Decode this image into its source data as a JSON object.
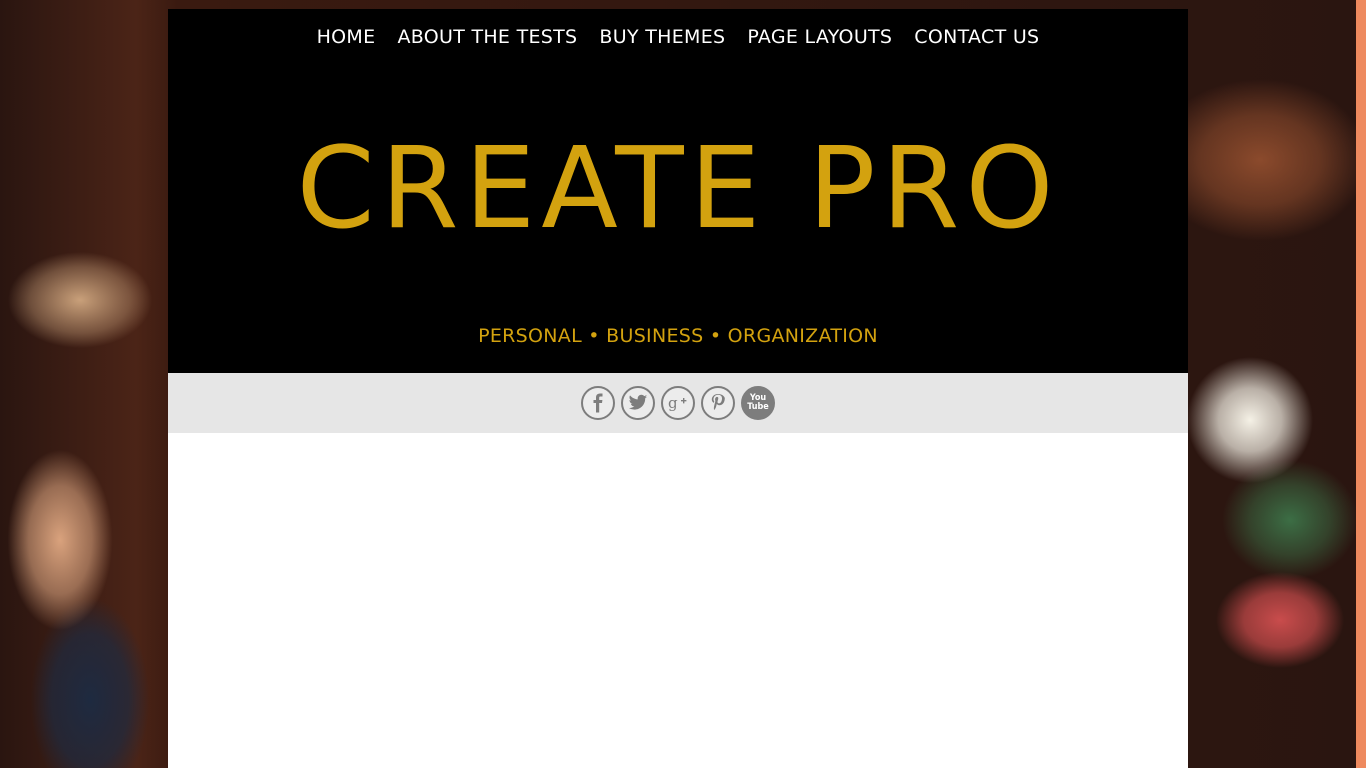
{
  "nav": {
    "items": [
      {
        "label": "HOME"
      },
      {
        "label": "ABOUT THE TESTS"
      },
      {
        "label": "BUY THEMES"
      },
      {
        "label": "PAGE LAYOUTS"
      },
      {
        "label": "CONTACT US"
      }
    ]
  },
  "header": {
    "title": "CREATE PRO",
    "tagline": "PERSONAL • BUSINESS • ORGANIZATION"
  },
  "social": {
    "icons": [
      {
        "name": "facebook-icon"
      },
      {
        "name": "twitter-icon"
      },
      {
        "name": "google-plus-icon"
      },
      {
        "name": "pinterest-icon"
      },
      {
        "name": "youtube-icon",
        "text_top": "You",
        "text_bottom": "Tube"
      }
    ]
  },
  "colors": {
    "accent": "#d3a20f",
    "header_bg": "#000000",
    "social_bar_bg": "#e6e6e6",
    "icon_gray": "#7d7d7d"
  }
}
